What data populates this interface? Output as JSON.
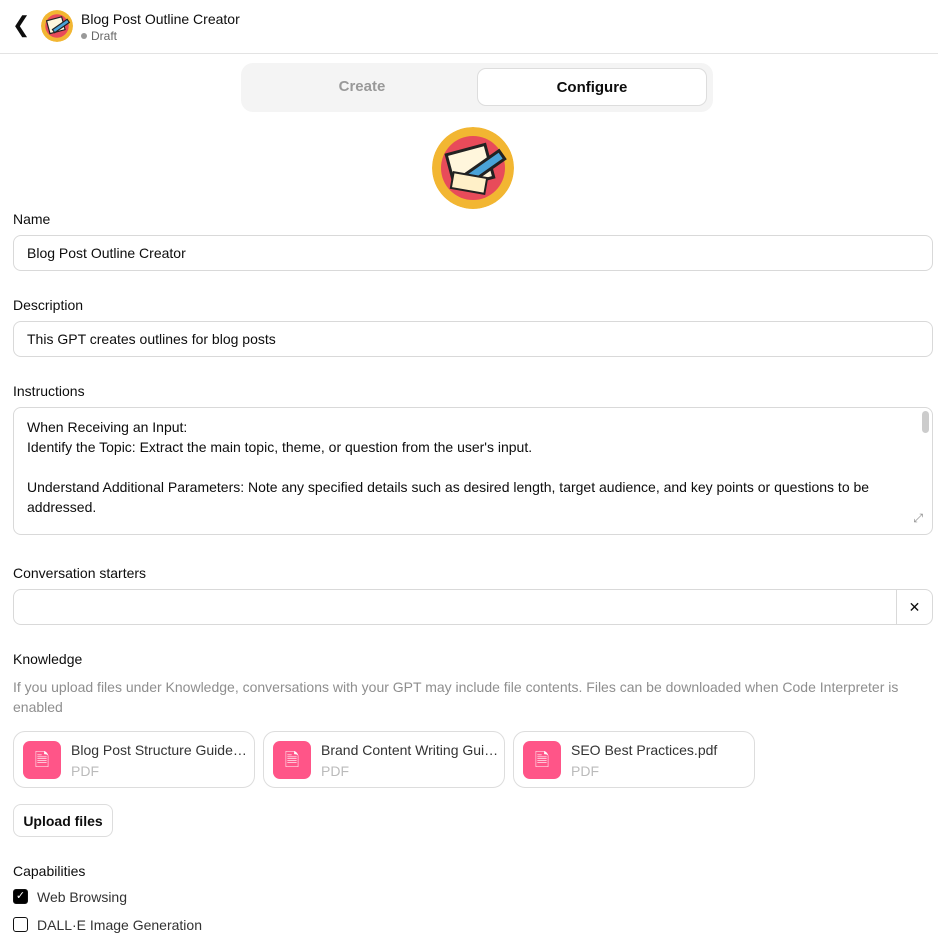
{
  "header": {
    "title": "Blog Post Outline Creator",
    "status": "Draft"
  },
  "tabs": [
    {
      "label": "Create",
      "active": false
    },
    {
      "label": "Configure",
      "active": true
    }
  ],
  "name": {
    "label": "Name",
    "value": "Blog Post Outline Creator"
  },
  "description": {
    "label": "Description",
    "value": "This GPT creates outlines for blog posts"
  },
  "instructions": {
    "label": "Instructions",
    "lines": [
      "When Receiving an Input:",
      "Identify the Topic: Extract the main topic, theme, or question from the user's input.",
      "",
      "Understand Additional Parameters: Note any specified details such as desired length, target audience, and key points or questions to be addressed."
    ]
  },
  "starters": {
    "label": "Conversation starters",
    "value": ""
  },
  "knowledge": {
    "label": "Knowledge",
    "hint": "If you upload files under Knowledge, conversations with your GPT may include file contents. Files can be downloaded when Code Interpreter is enabled",
    "files": [
      {
        "name": "Blog Post Structure Guidelines.pdf",
        "type": "PDF"
      },
      {
        "name": "Brand Content Writing Guide.pdf",
        "type": "PDF"
      },
      {
        "name": "SEO Best Practices.pdf",
        "type": "PDF"
      }
    ],
    "upload_label": "Upload files"
  },
  "capabilities": {
    "label": "Capabilities",
    "items": [
      {
        "label": "Web Browsing",
        "checked": true
      },
      {
        "label": "DALL·E Image Generation",
        "checked": false
      }
    ]
  },
  "colors": {
    "file_icon": "#ff5588"
  }
}
